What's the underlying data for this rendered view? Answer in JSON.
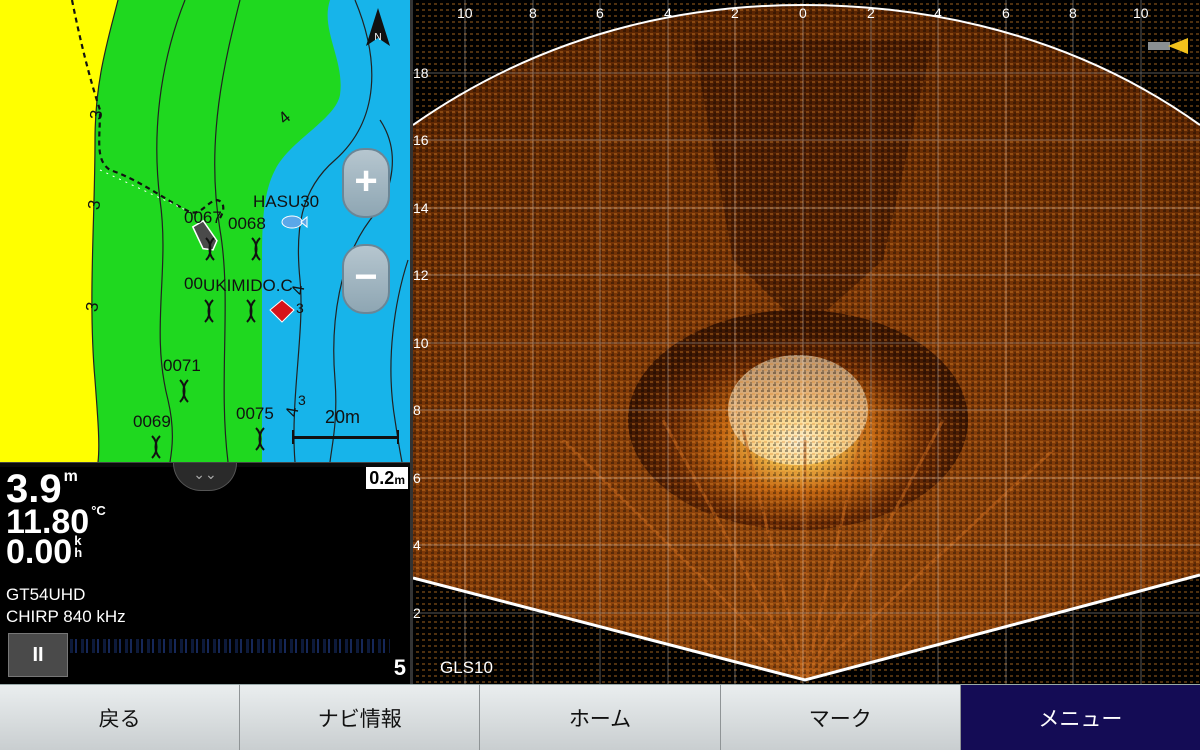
{
  "map": {
    "north_label": "N",
    "scale_label": "20m",
    "contour_labels": [
      "3",
      "3",
      "3",
      "4",
      "4",
      "3",
      "4",
      "3"
    ],
    "waypoints": [
      {
        "label": "0067"
      },
      {
        "label": "0068"
      },
      {
        "label": "HASU30"
      },
      {
        "label": "0071"
      },
      {
        "label": "0069"
      },
      {
        "label": "0075"
      },
      {
        "label": "00"
      },
      {
        "label": "UKIMIDO.C"
      }
    ],
    "zoom_in": "+",
    "zoom_out": "−",
    "colors": {
      "water": "#17b4ea",
      "shallow": "#1fd81f",
      "land": "#ffff00"
    }
  },
  "sonar": {
    "depth": "3.9",
    "depth_unit": "m",
    "temp": "11.80",
    "temp_unit": "°C",
    "speed": "0.00",
    "speed_unit": "kh",
    "transducer": "GT54UHD",
    "frequency": "CHIRP 840 kHz",
    "range": "0.2",
    "range_unit": "m",
    "pause": "II",
    "scale_number": "5",
    "collapse": "⌄⌄"
  },
  "scope": {
    "top_axis": [
      "10",
      "8",
      "6",
      "4",
      "2",
      "0",
      "2",
      "4",
      "6",
      "8",
      "10"
    ],
    "left_axis": [
      "18",
      "16",
      "14",
      "12",
      "10",
      "8",
      "6",
      "4",
      "2"
    ],
    "source_label": "GLS10"
  },
  "nav": {
    "items": [
      {
        "label": "戻る"
      },
      {
        "label": "ナビ情報"
      },
      {
        "label": "ホーム"
      },
      {
        "label": "マーク"
      },
      {
        "label": "メニュー"
      }
    ]
  }
}
